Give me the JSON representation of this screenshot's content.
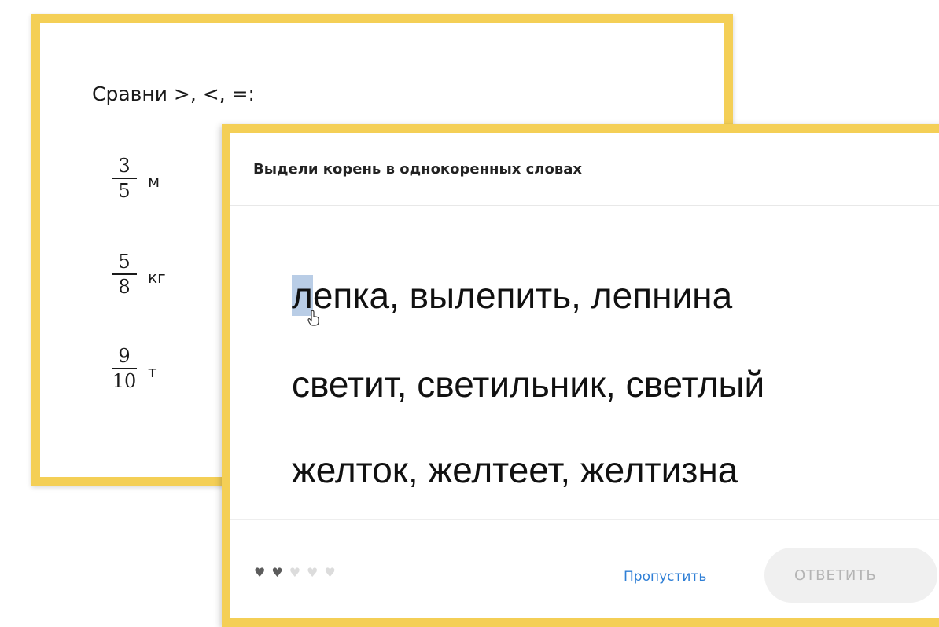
{
  "back_card": {
    "title": "Сравни >, <, =:",
    "rows": [
      {
        "numerator": "3",
        "denominator": "5",
        "unit": "м"
      },
      {
        "numerator": "5",
        "denominator": "8",
        "unit": "кг"
      },
      {
        "numerator": "9",
        "denominator": "10",
        "unit": "т"
      }
    ]
  },
  "front_card": {
    "title": "Выдели корень в однокоренных словах",
    "lines": [
      {
        "first": "л",
        "rest": "епка, вылепить, лепнина"
      },
      {
        "text": "светит, светильник, светлый"
      },
      {
        "text": "желток, желтеет, желтизна"
      }
    ],
    "lives": {
      "filled": 2,
      "total": 5
    },
    "skip_label": "Пропустить",
    "answer_label": "ОТВЕТИТЬ"
  },
  "colors": {
    "frame": "#f4cf56",
    "answer_box": "#f7e29a",
    "highlight": "#b9cde6",
    "link": "#2f7fd6"
  },
  "icons": [
    "heart-icon",
    "hand-cursor-icon"
  ]
}
